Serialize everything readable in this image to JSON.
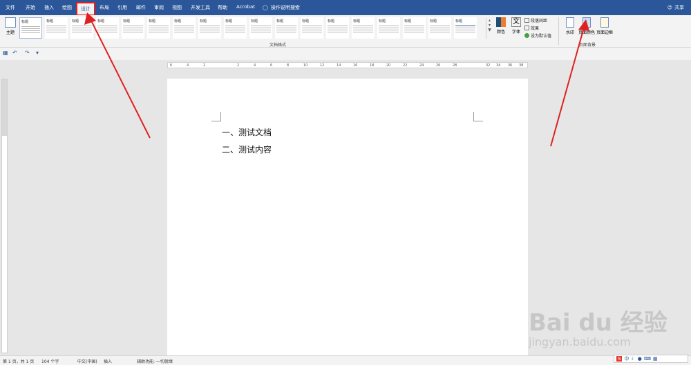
{
  "menubar": {
    "tabs": [
      "文件",
      "开始",
      "插入",
      "绘图",
      "设计",
      "布局",
      "引用",
      "邮件",
      "审阅",
      "视图",
      "开发工具",
      "帮助",
      "Acrobat"
    ],
    "active": "设计",
    "search": "操作说明搜索",
    "share": "共享"
  },
  "ribbon": {
    "theme_label": "主题",
    "styles": [
      "标题",
      "标题",
      "标题",
      "标题",
      "标题",
      "标题",
      "标题",
      "标题",
      "标题",
      "标题",
      "标题",
      "标题",
      "标题",
      "标题",
      "标题",
      "标题",
      "标题",
      "标题"
    ],
    "style_first": "标题",
    "gallery_label": "文档格式",
    "colors": "颜色",
    "fonts": "字体",
    "paragraph_spacing": "段落间距",
    "effects": "效果",
    "set_default": "设为默认值",
    "watermark": "水印",
    "page_color": "页面颜色",
    "page_borders": "页面边框",
    "bg_label": "页面背景"
  },
  "ruler": {
    "ticks": [
      "6",
      "4",
      "2",
      "2",
      "4",
      "6",
      "8",
      "10",
      "12",
      "14",
      "16",
      "18",
      "20",
      "22",
      "24",
      "26",
      "28",
      "32",
      "34",
      "36",
      "38"
    ]
  },
  "document": {
    "line1": "一、测试文档",
    "line2": "二、测试内容"
  },
  "status": {
    "page": "第 1 页，共 1 页",
    "words": "104 个字",
    "language": "中文(中国)",
    "mode": "插入",
    "accessibility": "辅助功能: 一切就绪"
  },
  "watermark": {
    "big": "Bai du 经验",
    "small": "jingyan.baidu.com"
  },
  "ime": {
    "label": "中"
  },
  "colors_theme": {
    "brand": "#2b579a",
    "highlight": "#e02020"
  }
}
